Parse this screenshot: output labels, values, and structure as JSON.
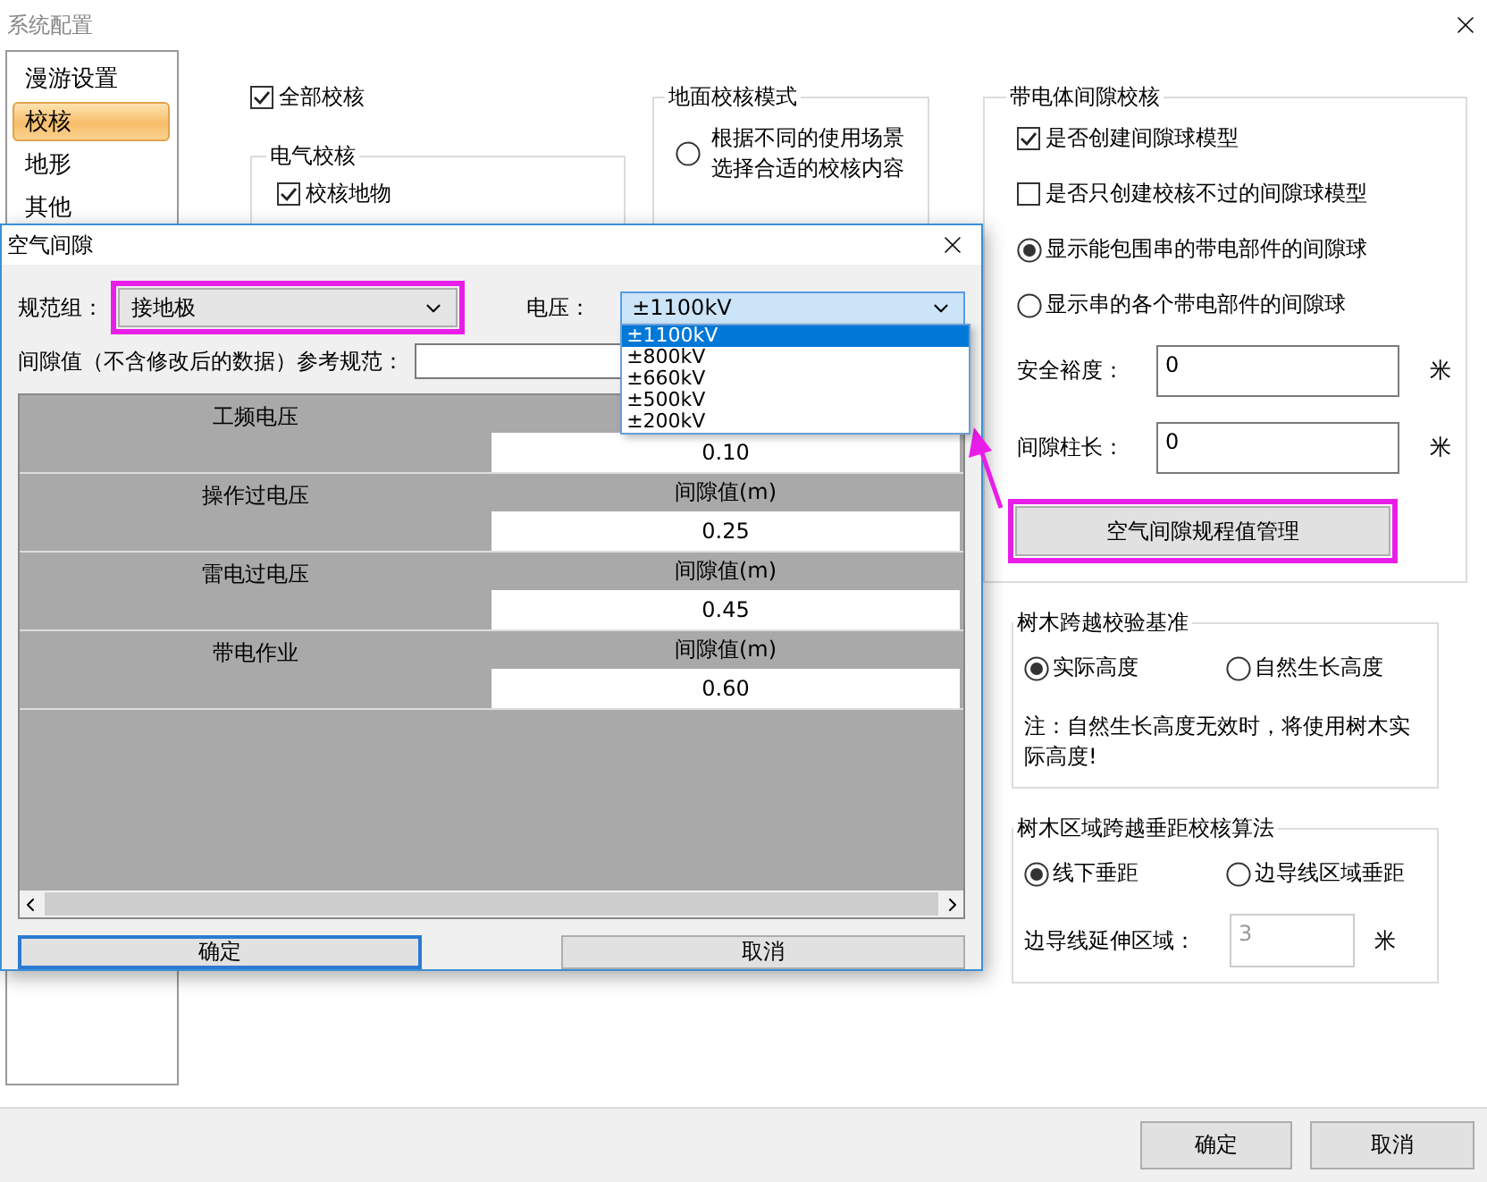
{
  "window": {
    "title": "系统配置"
  },
  "sidebar": {
    "items": [
      {
        "label": "漫游设置",
        "selected": false
      },
      {
        "label": "校核",
        "selected": true
      },
      {
        "label": "地形",
        "selected": false
      },
      {
        "label": "其他",
        "selected": false
      }
    ]
  },
  "check_all": {
    "label": "全部校核",
    "checked": true
  },
  "electrical_group": {
    "title": "电气校核",
    "items": [
      {
        "label": "校核地物",
        "checked": true
      }
    ]
  },
  "ground_mode_group": {
    "title": "地面校核模式",
    "options": [
      {
        "label": "根据不同的使用场景选择合适的校核内容",
        "selected": false
      }
    ]
  },
  "clearance_group": {
    "title": "带电体间隙校核",
    "checkboxes": [
      {
        "label": "是否创建间隙球模型",
        "checked": true
      },
      {
        "label": "是否只创建校核不过的间隙球模型",
        "checked": false
      }
    ],
    "radios": [
      {
        "label": "显示能包围串的带电部件的间隙球",
        "selected": true
      },
      {
        "label": "显示串的各个带电部件的间隙球",
        "selected": false
      }
    ],
    "fields": [
      {
        "label": "安全裕度：",
        "value": "0",
        "unit": "米"
      },
      {
        "label": "间隙柱长：",
        "value": "0",
        "unit": "米"
      }
    ],
    "manage_button": {
      "label": "空气间隙规程值管理",
      "highlighted": true
    }
  },
  "tree_group": {
    "title": "树木跨越校验基准",
    "options": [
      {
        "label": "实际高度",
        "selected": true
      },
      {
        "label": "自然生长高度",
        "selected": false
      }
    ],
    "note": "注：自然生长高度无效时，将使用树木实际高度!"
  },
  "tree_area_group": {
    "title": "树木区域跨越垂距校核算法",
    "options": [
      {
        "label": "线下垂距",
        "selected": true
      },
      {
        "label": "边导线区域垂距",
        "selected": false
      }
    ],
    "field": {
      "label": "边导线延伸区域：",
      "value": "3",
      "unit": "米",
      "disabled": true
    }
  },
  "footer_buttons": [
    "确定",
    "取消"
  ],
  "dialog": {
    "title": "空气间隙",
    "group_field": {
      "label": "规范组：",
      "value": "接地极",
      "highlighted": true
    },
    "voltage_field": {
      "label": "电压：",
      "value": "±1100kV",
      "expanded": true,
      "options": [
        {
          "label": "±1100kV",
          "selected": true
        },
        {
          "label": "±800kV",
          "selected": false
        },
        {
          "label": "±660kV",
          "selected": false
        },
        {
          "label": "±500kV",
          "selected": false
        },
        {
          "label": "±200kV",
          "selected": false
        }
      ]
    },
    "reference_field": {
      "label": "间隙值（不含修改后的数据）参考规范："
    },
    "table": {
      "rows": [
        {
          "name": "工频电压",
          "value": "0.10"
        },
        {
          "name": "操作过电压",
          "header": "间隙值(m)",
          "value": "0.25"
        },
        {
          "name": "雷电过电压",
          "header": "间隙值(m)",
          "value": "0.45"
        },
        {
          "name": "带电作业",
          "header": "间隙值(m)",
          "value": "0.60"
        }
      ]
    },
    "buttons": [
      {
        "label": "确定",
        "focused": true
      },
      {
        "label": "取消",
        "focused": false
      }
    ]
  }
}
